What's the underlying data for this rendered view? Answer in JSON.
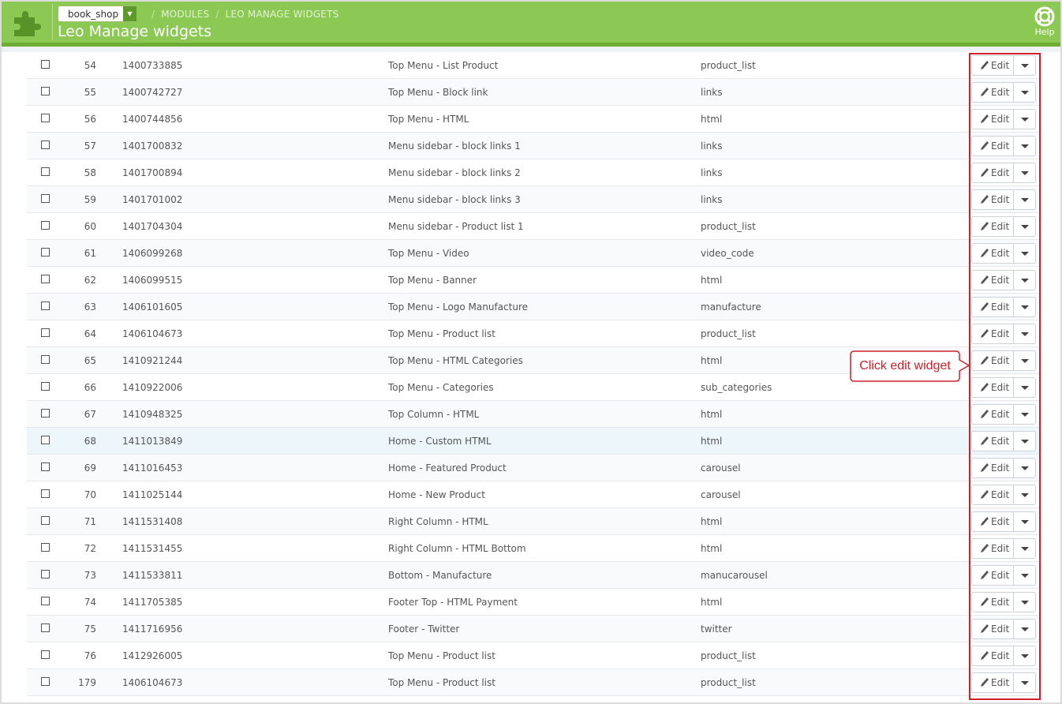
{
  "header": {
    "shop_selector": "book_shop",
    "breadcrumbs": [
      "MODULES",
      "LEO MANAGE WIDGETS"
    ],
    "title": "Leo Manage widgets",
    "help_label": "Help"
  },
  "colors": {
    "header_green": "#8bc954",
    "annotation_red": "#d0202a"
  },
  "row_button": {
    "edit_label": "Edit"
  },
  "rows": [
    {
      "id": "54",
      "key": "1400733885",
      "name": "Top Menu - List Product",
      "type": "product_list"
    },
    {
      "id": "55",
      "key": "1400742727",
      "name": "Top Menu - Block link",
      "type": "links"
    },
    {
      "id": "56",
      "key": "1400744856",
      "name": "Top Menu - HTML",
      "type": "html"
    },
    {
      "id": "57",
      "key": "1401700832",
      "name": "Menu sidebar - block links 1",
      "type": "links"
    },
    {
      "id": "58",
      "key": "1401700894",
      "name": "Menu sidebar - block links 2",
      "type": "links"
    },
    {
      "id": "59",
      "key": "1401701002",
      "name": "Menu sidebar - block links 3",
      "type": "links"
    },
    {
      "id": "60",
      "key": "1401704304",
      "name": "Menu sidebar - Product list 1",
      "type": "product_list"
    },
    {
      "id": "61",
      "key": "1406099268",
      "name": "Top Menu - Video",
      "type": "video_code"
    },
    {
      "id": "62",
      "key": "1406099515",
      "name": "Top Menu - Banner",
      "type": "html"
    },
    {
      "id": "63",
      "key": "1406101605",
      "name": "Top Menu - Logo Manufacture",
      "type": "manufacture"
    },
    {
      "id": "64",
      "key": "1406104673",
      "name": "Top Menu - Product list",
      "type": "product_list"
    },
    {
      "id": "65",
      "key": "1410921244",
      "name": "Top Menu - HTML Categories",
      "type": "html"
    },
    {
      "id": "66",
      "key": "1410922006",
      "name": "Top Menu - Categories",
      "type": "sub_categories"
    },
    {
      "id": "67",
      "key": "1410948325",
      "name": "Top Column - HTML",
      "type": "html"
    },
    {
      "id": "68",
      "key": "1411013849",
      "name": "Home - Custom HTML",
      "type": "html"
    },
    {
      "id": "69",
      "key": "1411016453",
      "name": "Home - Featured Product",
      "type": "carousel"
    },
    {
      "id": "70",
      "key": "1411025144",
      "name": "Home - New Product",
      "type": "carousel"
    },
    {
      "id": "71",
      "key": "1411531408",
      "name": "Right Column - HTML",
      "type": "html"
    },
    {
      "id": "72",
      "key": "1411531455",
      "name": "Right Column - HTML Bottom",
      "type": "html"
    },
    {
      "id": "73",
      "key": "1411533811",
      "name": "Bottom - Manufacture",
      "type": "manucarousel"
    },
    {
      "id": "74",
      "key": "1411705385",
      "name": "Footer Top - HTML Payment",
      "type": "html"
    },
    {
      "id": "75",
      "key": "1411716956",
      "name": "Footer - Twitter",
      "type": "twitter"
    },
    {
      "id": "76",
      "key": "1412926005",
      "name": "Top Menu - Product list",
      "type": "product_list"
    },
    {
      "id": "179",
      "key": "1406104673",
      "name": "Top Menu - Product list",
      "type": "product_list"
    }
  ],
  "annotation": {
    "callout_text": "Click edit widget"
  }
}
